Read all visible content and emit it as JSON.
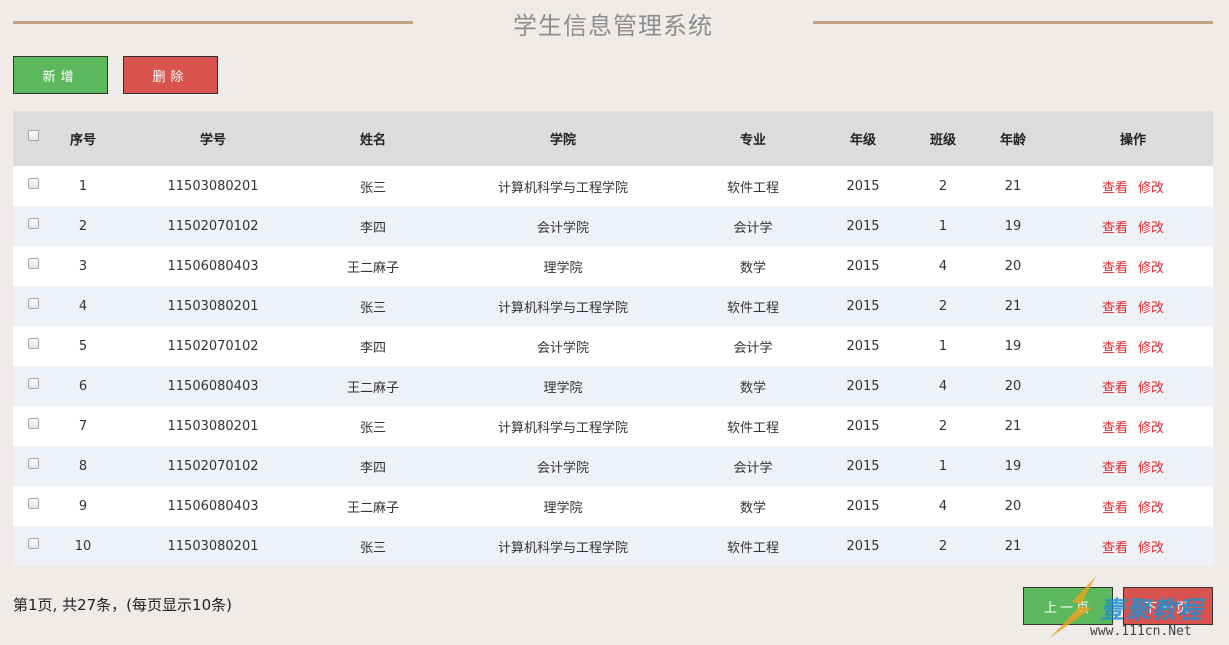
{
  "header": {
    "title": "学生信息管理系统"
  },
  "toolbar": {
    "add_label": "新增",
    "delete_label": "删除"
  },
  "table": {
    "columns": [
      "序号",
      "学号",
      "姓名",
      "学院",
      "专业",
      "年级",
      "班级",
      "年龄",
      "操作"
    ],
    "rows": [
      {
        "no": "1",
        "sid": "11503080201",
        "name": "张三",
        "college": "计算机科学与工程学院",
        "major": "软件工程",
        "grade": "2015",
        "cls": "2",
        "age": "21"
      },
      {
        "no": "2",
        "sid": "11502070102",
        "name": "李四",
        "college": "会计学院",
        "major": "会计学",
        "grade": "2015",
        "cls": "1",
        "age": "19"
      },
      {
        "no": "3",
        "sid": "11506080403",
        "name": "王二麻子",
        "college": "理学院",
        "major": "数学",
        "grade": "2015",
        "cls": "4",
        "age": "20"
      },
      {
        "no": "4",
        "sid": "11503080201",
        "name": "张三",
        "college": "计算机科学与工程学院",
        "major": "软件工程",
        "grade": "2015",
        "cls": "2",
        "age": "21"
      },
      {
        "no": "5",
        "sid": "11502070102",
        "name": "李四",
        "college": "会计学院",
        "major": "会计学",
        "grade": "2015",
        "cls": "1",
        "age": "19"
      },
      {
        "no": "6",
        "sid": "11506080403",
        "name": "王二麻子",
        "college": "理学院",
        "major": "数学",
        "grade": "2015",
        "cls": "4",
        "age": "20"
      },
      {
        "no": "7",
        "sid": "11503080201",
        "name": "张三",
        "college": "计算机科学与工程学院",
        "major": "软件工程",
        "grade": "2015",
        "cls": "2",
        "age": "21"
      },
      {
        "no": "8",
        "sid": "11502070102",
        "name": "李四",
        "college": "会计学院",
        "major": "会计学",
        "grade": "2015",
        "cls": "1",
        "age": "19"
      },
      {
        "no": "9",
        "sid": "11506080403",
        "name": "王二麻子",
        "college": "理学院",
        "major": "数学",
        "grade": "2015",
        "cls": "4",
        "age": "20"
      },
      {
        "no": "10",
        "sid": "11503080201",
        "name": "张三",
        "college": "计算机科学与工程学院",
        "major": "软件工程",
        "grade": "2015",
        "cls": "2",
        "age": "21"
      }
    ],
    "view_label": "查看",
    "edit_label": "修改"
  },
  "footer": {
    "pagination_text": "第1页, 共27条，(每页显示10条)",
    "prev_label": "上一页",
    "next_label": "下一页"
  },
  "watermark": {
    "brand": "壹聚教程",
    "url": "www.111cn.Net"
  },
  "colors": {
    "background": "#efebe8",
    "title_rule": "#c4a183",
    "add_button": "#5cb85c",
    "delete_button": "#d9534f",
    "header_row": "#dadcde",
    "alt_row": "#eef1f8",
    "action_link": "#e02a2a"
  }
}
